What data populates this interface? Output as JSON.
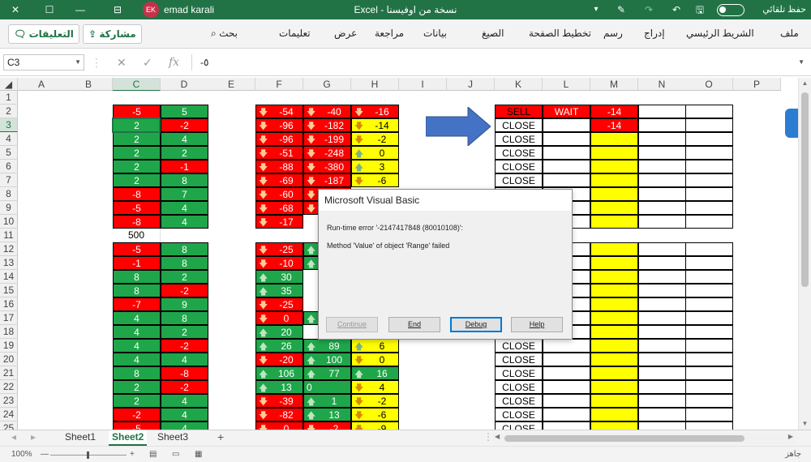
{
  "titlebar": {
    "close_glyph": "✕",
    "restore_glyph": "☐",
    "minimize_glyph": "—",
    "user_initials": "EK",
    "user_name": "emad karali",
    "doc_title": "Excel  -  نسخة من اوفيسنا",
    "autosave_label": "حفظ تلقائي",
    "pen_glyph": "✎",
    "redo_glyph": "↷",
    "undo_glyph": "↶",
    "save_glyph": "🖫",
    "customize_glyph": "▾"
  },
  "ribbon": {
    "comments_label": "التعليقات",
    "share_label": "مشاركة",
    "search_label": "بحث",
    "tabs": [
      "ملف",
      "الشريط الرئيسي",
      "إدراج",
      "رسم",
      "تخطيط الصفحة",
      "الصيغ",
      "بيانات",
      "مراجعة",
      "عرض",
      "تعليمات"
    ]
  },
  "formula_bar": {
    "name_box": "C3",
    "formula": "-٥",
    "cancel_glyph": "✕",
    "enter_glyph": "✓",
    "fx_glyph": "fx"
  },
  "grid": {
    "columns": [
      "A",
      "B",
      "C",
      "D",
      "E",
      "F",
      "G",
      "H",
      "I",
      "J",
      "K",
      "L",
      "M",
      "N",
      "O",
      "P"
    ],
    "rows": [
      "1",
      "2",
      "3",
      "4",
      "5",
      "6",
      "7",
      "8",
      "9",
      "10",
      "11",
      "12",
      "13",
      "14",
      "15",
      "16",
      "17",
      "18",
      "19",
      "20",
      "21",
      "22",
      "23",
      "24",
      "25"
    ],
    "selected_col": "C",
    "selected_row": "3",
    "C": [
      "",
      "-5",
      "2",
      "2",
      "2",
      "2",
      "2",
      "-8",
      "-5",
      "-8",
      "500",
      "-5",
      "-1",
      "8",
      "8",
      "-7",
      "4",
      "4",
      "4",
      "4",
      "8",
      "2",
      "2",
      "-2",
      "-5"
    ],
    "C_color": [
      "",
      "r",
      "g",
      "g",
      "g",
      "g",
      "g",
      "r",
      "r",
      "r",
      "",
      "r",
      "r",
      "g",
      "g",
      "r",
      "g",
      "g",
      "g",
      "g",
      "g",
      "g",
      "g",
      "r",
      "r"
    ],
    "D": [
      "",
      "5",
      "-2",
      "4",
      "2",
      "-1",
      "8",
      "7",
      "4",
      "4",
      "",
      "8",
      "8",
      "2",
      "-2",
      "9",
      "8",
      "2",
      "-2",
      "4",
      "-8",
      "-2",
      "4",
      "4",
      "4"
    ],
    "D_color": [
      "",
      "g",
      "r",
      "g",
      "g",
      "r",
      "g",
      "g",
      "g",
      "g",
      "",
      "g",
      "g",
      "g",
      "r",
      "g",
      "g",
      "g",
      "r",
      "g",
      "r",
      "r",
      "g",
      "g",
      "g"
    ],
    "F": [
      "",
      "-54",
      "-96",
      "-96",
      "-51",
      "-88",
      "-69",
      "-60",
      "-68",
      "-17",
      "",
      "-25",
      "-10",
      "30",
      "35",
      "-25",
      "0",
      "20",
      "26",
      "-20",
      "106",
      "13",
      "-39",
      "-82",
      "0"
    ],
    "F_dir": [
      "",
      "down",
      "down",
      "down",
      "down",
      "down",
      "down",
      "down",
      "down",
      "down",
      "",
      "down",
      "down",
      "up",
      "up",
      "down",
      "down",
      "up",
      "up",
      "down",
      "up",
      "up",
      "down",
      "down",
      "down"
    ],
    "F_color": [
      "",
      "r",
      "r",
      "r",
      "r",
      "r",
      "r",
      "r",
      "r",
      "r",
      "",
      "r",
      "r",
      "g",
      "g",
      "r",
      "r",
      "g",
      "g",
      "r",
      "g",
      "g",
      "r",
      "r",
      "r"
    ],
    "G": [
      "",
      "-40",
      "-182",
      "-199",
      "-248",
      "-380",
      "-187",
      "",
      "",
      "",
      "",
      "",
      "",
      "",
      "",
      "",
      "",
      "",
      "89",
      "100",
      "77",
      "0",
      "1",
      "13",
      "-2"
    ],
    "G_dir": [
      "",
      "down",
      "down",
      "down",
      "down",
      "down",
      "down",
      "down",
      "down",
      "",
      "",
      "up",
      "up",
      "",
      "",
      "",
      "up",
      "",
      "up",
      "up",
      "up",
      "",
      "up",
      "up",
      "down"
    ],
    "G_color": [
      "",
      "r",
      "r",
      "r",
      "r",
      "r",
      "r",
      "r",
      "r",
      "",
      "",
      "g",
      "g",
      "",
      "",
      "",
      "g",
      "",
      "g",
      "g",
      "g",
      "g",
      "g",
      "g",
      "r"
    ],
    "H": [
      "",
      "-16",
      "-14",
      "-2",
      "0",
      "3",
      "-6",
      "",
      "",
      "",
      "",
      "",
      "",
      "",
      "",
      "",
      "",
      "",
      "6",
      "0",
      "16",
      "4",
      "-2",
      "-6",
      "-9"
    ],
    "H_dir": [
      "",
      "down",
      "down",
      "down",
      "up",
      "up",
      "down",
      "",
      "",
      "",
      "",
      "",
      "",
      "",
      "",
      "",
      "",
      "",
      "up",
      "down",
      "up",
      "down",
      "down",
      "down",
      "down"
    ],
    "H_color": [
      "",
      "r",
      "y",
      "y",
      "y",
      "y",
      "y",
      "",
      "",
      "",
      "",
      "",
      "",
      "",
      "",
      "",
      "",
      "",
      "y",
      "y",
      "g",
      "y",
      "y",
      "y",
      "y"
    ],
    "K": [
      "",
      "SELL",
      "CLOSE",
      "CLOSE",
      "CLOSE",
      "CLOSE",
      "CLOSE",
      "",
      "",
      "",
      "",
      "",
      "",
      "",
      "",
      "",
      "",
      "",
      "CLOSE",
      "CLOSE",
      "CLOSE",
      "CLOSE",
      "CLOSE",
      "CLOSE",
      "CLOSE"
    ],
    "L": [
      "",
      "WAIT"
    ],
    "M": [
      "",
      "-14",
      "-14"
    ]
  },
  "dialog": {
    "title": "Microsoft Visual Basic",
    "error_line": "Run-time error '-2147417848 (80010108)':",
    "message": "Method 'Value' of object 'Range' failed",
    "continue_label": "Continue",
    "end_label": "End",
    "debug_label": "Debug",
    "help_label": "Help"
  },
  "sheets": {
    "tabs": [
      "Sheet1",
      "Sheet2",
      "Sheet3"
    ],
    "active": "Sheet2",
    "add_glyph": "+"
  },
  "status": {
    "ready": "جاهز",
    "zoom": "100%",
    "zoom_out": "—",
    "zoom_in": "+"
  },
  "colors": {
    "excel_green": "#217346",
    "cell_red": "#ff0000",
    "cell_green": "#1fa64a",
    "cell_yellow": "#ffff00",
    "arrow_blue": "#4472c4"
  }
}
